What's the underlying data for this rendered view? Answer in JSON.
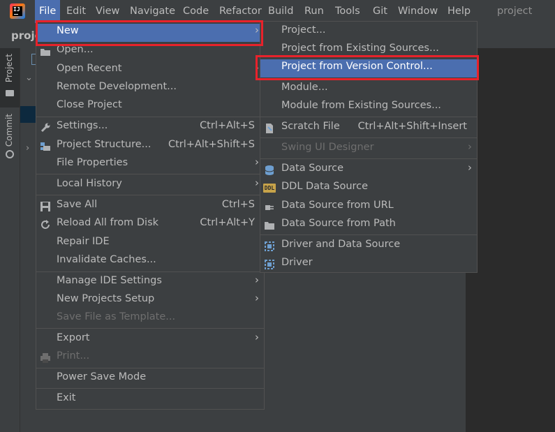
{
  "menubar": {
    "items": [
      "File",
      "Edit",
      "View",
      "Navigate",
      "Code",
      "Refactor",
      "Build",
      "Run",
      "Tools",
      "Git",
      "Window",
      "Help"
    ],
    "project_title": "project"
  },
  "toolbar": {
    "project_crumb": "proje"
  },
  "tool_window_tabs": {
    "project": "Project",
    "commit": "Commit"
  },
  "file_menu": {
    "items": [
      {
        "label": "New",
        "submenu": true
      },
      {
        "label": "Open..."
      },
      {
        "label": "Open Recent",
        "submenu": true
      },
      {
        "label": "Remote Development..."
      },
      {
        "label": "Close Project"
      },
      {
        "label": "Settings...",
        "shortcut": "Ctrl+Alt+S"
      },
      {
        "label": "Project Structure...",
        "shortcut": "Ctrl+Alt+Shift+S"
      },
      {
        "label": "File Properties",
        "submenu": true
      },
      {
        "label": "Local History",
        "submenu": true
      },
      {
        "label": "Save All",
        "shortcut": "Ctrl+S"
      },
      {
        "label": "Reload All from Disk",
        "shortcut": "Ctrl+Alt+Y"
      },
      {
        "label": "Repair IDE"
      },
      {
        "label": "Invalidate Caches..."
      },
      {
        "label": "Manage IDE Settings",
        "submenu": true
      },
      {
        "label": "New Projects Setup",
        "submenu": true
      },
      {
        "label": "Save File as Template...",
        "disabled": true
      },
      {
        "label": "Export",
        "submenu": true
      },
      {
        "label": "Print...",
        "disabled": true
      },
      {
        "label": "Power Save Mode"
      },
      {
        "label": "Exit"
      }
    ]
  },
  "new_submenu": {
    "items": [
      {
        "label": "Project..."
      },
      {
        "label": "Project from Existing Sources..."
      },
      {
        "label": "Project from Version Control..."
      },
      {
        "label": "Module..."
      },
      {
        "label": "Module from Existing Sources..."
      },
      {
        "label": "Scratch File",
        "shortcut": "Ctrl+Alt+Shift+Insert"
      },
      {
        "label": "Swing UI Designer",
        "disabled": true,
        "submenu": true
      },
      {
        "label": "Data Source",
        "submenu": true
      },
      {
        "label": "DDL Data Source"
      },
      {
        "label": "Data Source from URL"
      },
      {
        "label": "Data Source from Path"
      },
      {
        "label": "Driver and Data Source"
      },
      {
        "label": "Driver"
      }
    ]
  },
  "icons": {
    "ddl_text": "DDL",
    "logo_text": "IJ"
  },
  "colors": {
    "highlight": "#4b6eaf",
    "annotation_red": "#e8222b",
    "menu_bg": "#3c3f41"
  }
}
